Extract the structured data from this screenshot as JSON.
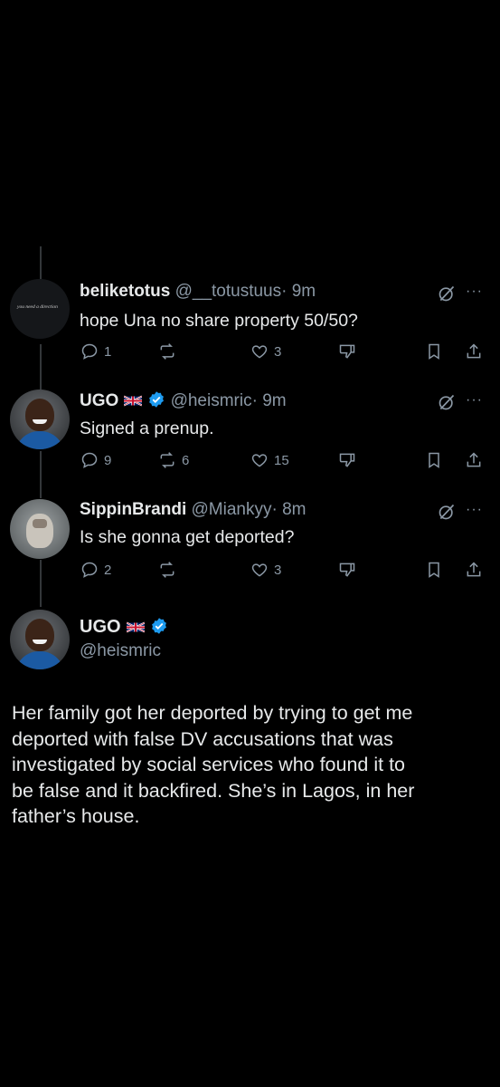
{
  "replies": [
    {
      "name": "beliketotus",
      "handle": "@__totustuus",
      "time": "· 9m",
      "text": "hope Una no share property 50/50?",
      "avatar_text": "you need a direction",
      "has_flag": false,
      "verified": false,
      "reply_count": "1",
      "repost_count": "",
      "like_count": "3"
    },
    {
      "name": "UGO",
      "handle": "@heismric",
      "time": "· 9m",
      "text": "Signed a prenup.",
      "has_flag": true,
      "verified": true,
      "reply_count": "9",
      "repost_count": "6",
      "like_count": "15"
    },
    {
      "name": "SippinBrandi",
      "handle": "@Miankyy",
      "time": "· 8m",
      "text": "Is she gonna get deported?",
      "has_flag": false,
      "verified": false,
      "reply_count": "2",
      "repost_count": "",
      "like_count": "3"
    }
  ],
  "main": {
    "name": "UGO",
    "handle": "@heismric",
    "text_lines": [
      "Her family got her deported by trying to get me",
      "deported with false DV accusations that was",
      "investigated by social services who found it to",
      "be false and it backfired. She’s in Lagos, in her",
      "father’s house."
    ]
  },
  "icons": {
    "more": "···",
    "colors": {
      "verified": "#1d9bf0",
      "muted": "#8b98a5",
      "text": "#e7e9ea"
    }
  }
}
